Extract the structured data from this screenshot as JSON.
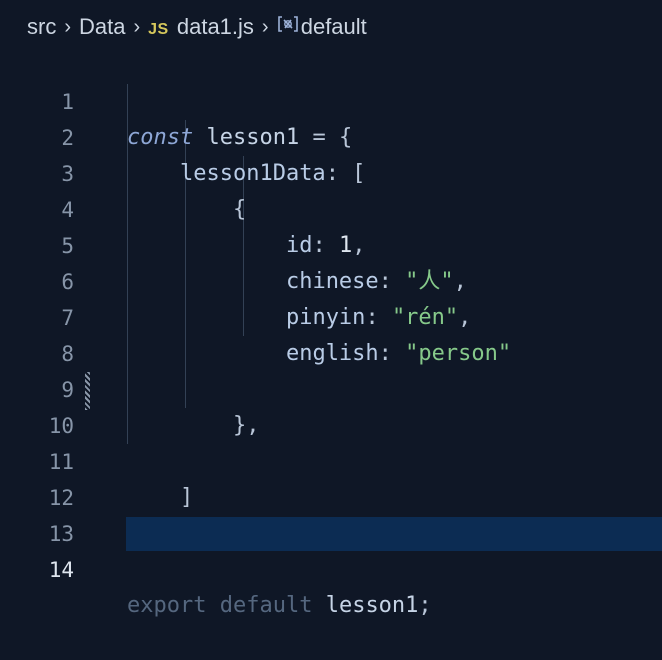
{
  "breadcrumb": {
    "folder1": "src",
    "folder2": "Data",
    "file_badge": "JS",
    "file": "data1.js",
    "symbol": "default"
  },
  "code": {
    "line_numbers": [
      "1",
      "2",
      "3",
      "4",
      "5",
      "6",
      "7",
      "8",
      "9",
      "10",
      "11",
      "12",
      "13",
      "14"
    ],
    "active_line": "14",
    "l1": {
      "kw": "const",
      "name": "lesson1",
      "rest": " = {"
    },
    "l2": {
      "key": "lesson1Data",
      "rest": ": ["
    },
    "l3": {
      "text": "{"
    },
    "l4": {
      "key": "id",
      "colon": ": ",
      "value": "1",
      "end": ","
    },
    "l5": {
      "key": "chinese",
      "colon": ": ",
      "value": "\"人\"",
      "end": ","
    },
    "l6": {
      "key": "pinyin",
      "colon": ": ",
      "value": "\"rén\"",
      "end": ","
    },
    "l7": {
      "key": "english",
      "colon": ": ",
      "value": "\"person\""
    },
    "l9": {
      "text": "},"
    },
    "l11": {
      "text": "]"
    },
    "l12": {
      "text": "}"
    },
    "l14": {
      "kw1": "export",
      "kw2": "default",
      "name": "lesson1",
      "end": ";"
    }
  },
  "colors": {
    "background": "#0f1726",
    "string": "#86c98a",
    "keyword": "#8ea7d6",
    "highlight": "#0c2c53",
    "js_badge": "#d6c85c"
  }
}
